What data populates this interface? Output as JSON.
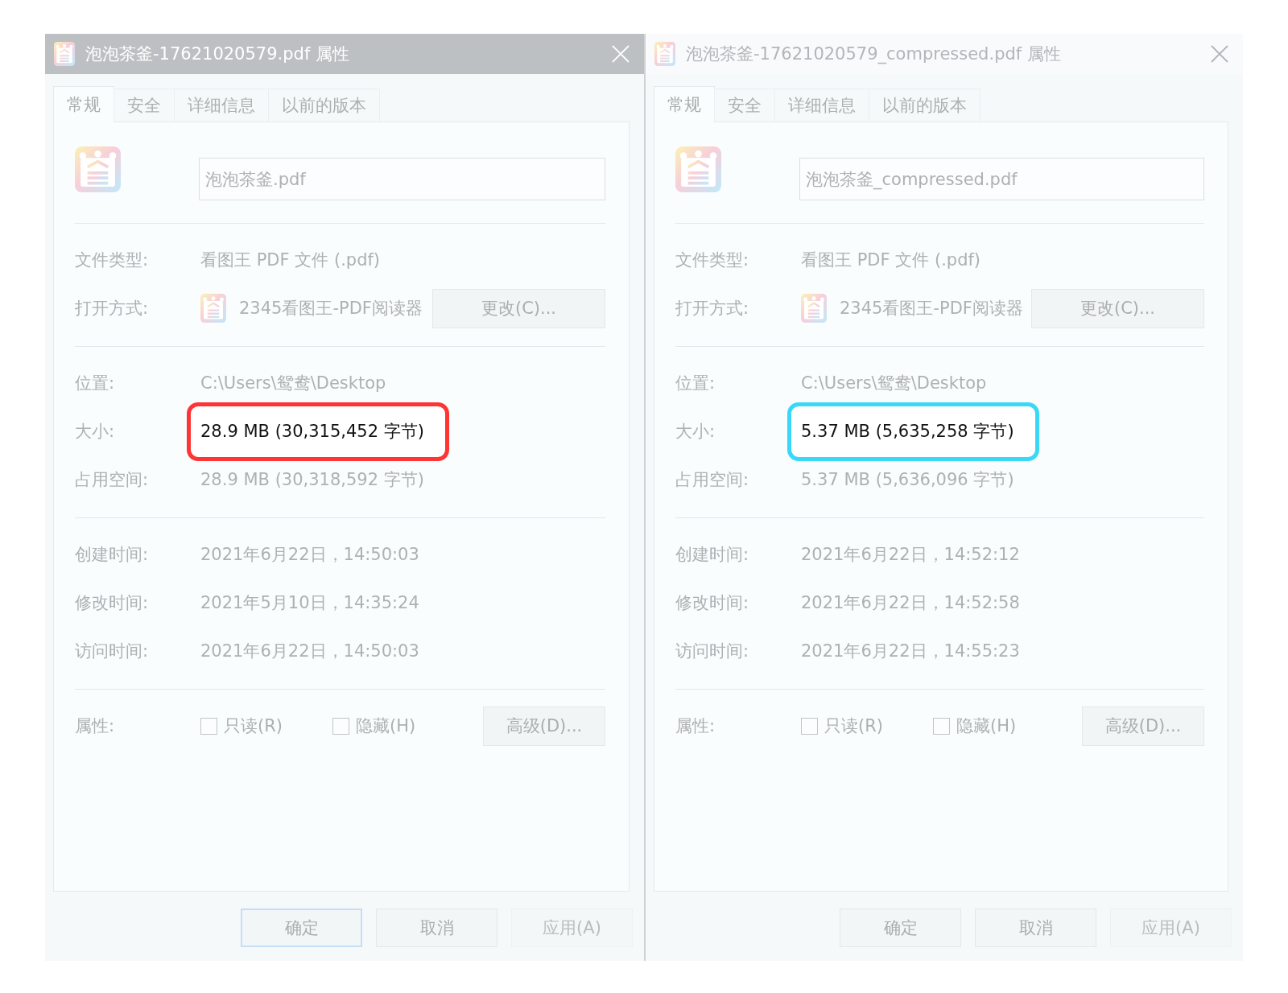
{
  "dialogs": [
    {
      "title": "泡泡茶釜-17621020579.pdf 属性",
      "active": true,
      "tabs": [
        {
          "label": "常规",
          "selected": true
        },
        {
          "label": "安全",
          "selected": false
        },
        {
          "label": "详细信息",
          "selected": false
        },
        {
          "label": "以前的版本",
          "selected": false
        }
      ],
      "file_name": {
        "value": "泡泡茶釜.pdf"
      },
      "sections": [
        [
          {
            "kind": "text",
            "label": "文件类型:",
            "value": "看图王 PDF 文件 (.pdf)"
          },
          {
            "kind": "app",
            "label": "打开方式:",
            "value": "2345看图王-PDF阅读器",
            "button": "更改(C)..."
          }
        ],
        [
          {
            "kind": "text",
            "label": "位置:",
            "value": "C:\\Users\\鸳鸯\\Desktop"
          },
          {
            "kind": "text",
            "label": "大小:",
            "value": "28.9 MB (30,315,452 字节)",
            "color": "#ff3434"
          },
          {
            "kind": "text",
            "label": "占用空间:",
            "value": "28.9 MB (30,318,592 字节)"
          }
        ],
        [
          {
            "kind": "text",
            "label": "创建时间:",
            "value": "2021年6月22日，14:50:03"
          },
          {
            "kind": "text",
            "label": "修改时间:",
            "value": "2021年5月10日，14:35:24"
          },
          {
            "kind": "text",
            "label": "访问时间:",
            "value": "2021年6月22日，14:50:03"
          }
        ],
        [
          {
            "kind": "attributes",
            "label": "属性:",
            "checkboxes": [
              {
                "label": "只读(R)",
                "checked": false
              },
              {
                "label": "隐藏(H)",
                "checked": false
              }
            ],
            "button": "高级(D)..."
          }
        ]
      ],
      "buttons": [
        {
          "label": "确定",
          "default": true,
          "disabled": false
        },
        {
          "label": "取消",
          "default": false,
          "disabled": false
        },
        {
          "label": "应用(A)",
          "default": false,
          "disabled": true
        }
      ]
    },
    {
      "title": "泡泡茶釜-17621020579_compressed.pdf 属性",
      "active": false,
      "tabs": [
        {
          "label": "常规",
          "selected": true
        },
        {
          "label": "安全",
          "selected": false
        },
        {
          "label": "详细信息",
          "selected": false
        },
        {
          "label": "以前的版本",
          "selected": false
        }
      ],
      "file_name": {
        "value": "泡泡茶釜_compressed.pdf"
      },
      "sections": [
        [
          {
            "kind": "text",
            "label": "文件类型:",
            "value": "看图王 PDF 文件 (.pdf)"
          },
          {
            "kind": "app",
            "label": "打开方式:",
            "value": "2345看图王-PDF阅读器",
            "button": "更改(C)..."
          }
        ],
        [
          {
            "kind": "text",
            "label": "位置:",
            "value": "C:\\Users\\鸳鸯\\Desktop"
          },
          {
            "kind": "text",
            "label": "大小:",
            "value": "5.37 MB (5,635,258 字节)",
            "color": "#3ad8f8"
          },
          {
            "kind": "text",
            "label": "占用空间:",
            "value": "5.37 MB (5,636,096 字节)"
          }
        ],
        [
          {
            "kind": "text",
            "label": "创建时间:",
            "value": "2021年6月22日，14:52:12"
          },
          {
            "kind": "text",
            "label": "修改时间:",
            "value": "2021年6月22日，14:52:58"
          },
          {
            "kind": "text",
            "label": "访问时间:",
            "value": "2021年6月22日，14:55:23"
          }
        ],
        [
          {
            "kind": "attributes",
            "label": "属性:",
            "checkboxes": [
              {
                "label": "只读(R)",
                "checked": false
              },
              {
                "label": "隐藏(H)",
                "checked": false
              }
            ],
            "button": "高级(D)..."
          }
        ]
      ],
      "buttons": [
        {
          "label": "确定",
          "default": false,
          "disabled": false
        },
        {
          "label": "取消",
          "default": false,
          "disabled": false
        },
        {
          "label": "应用(A)",
          "default": false,
          "disabled": true
        }
      ]
    }
  ]
}
